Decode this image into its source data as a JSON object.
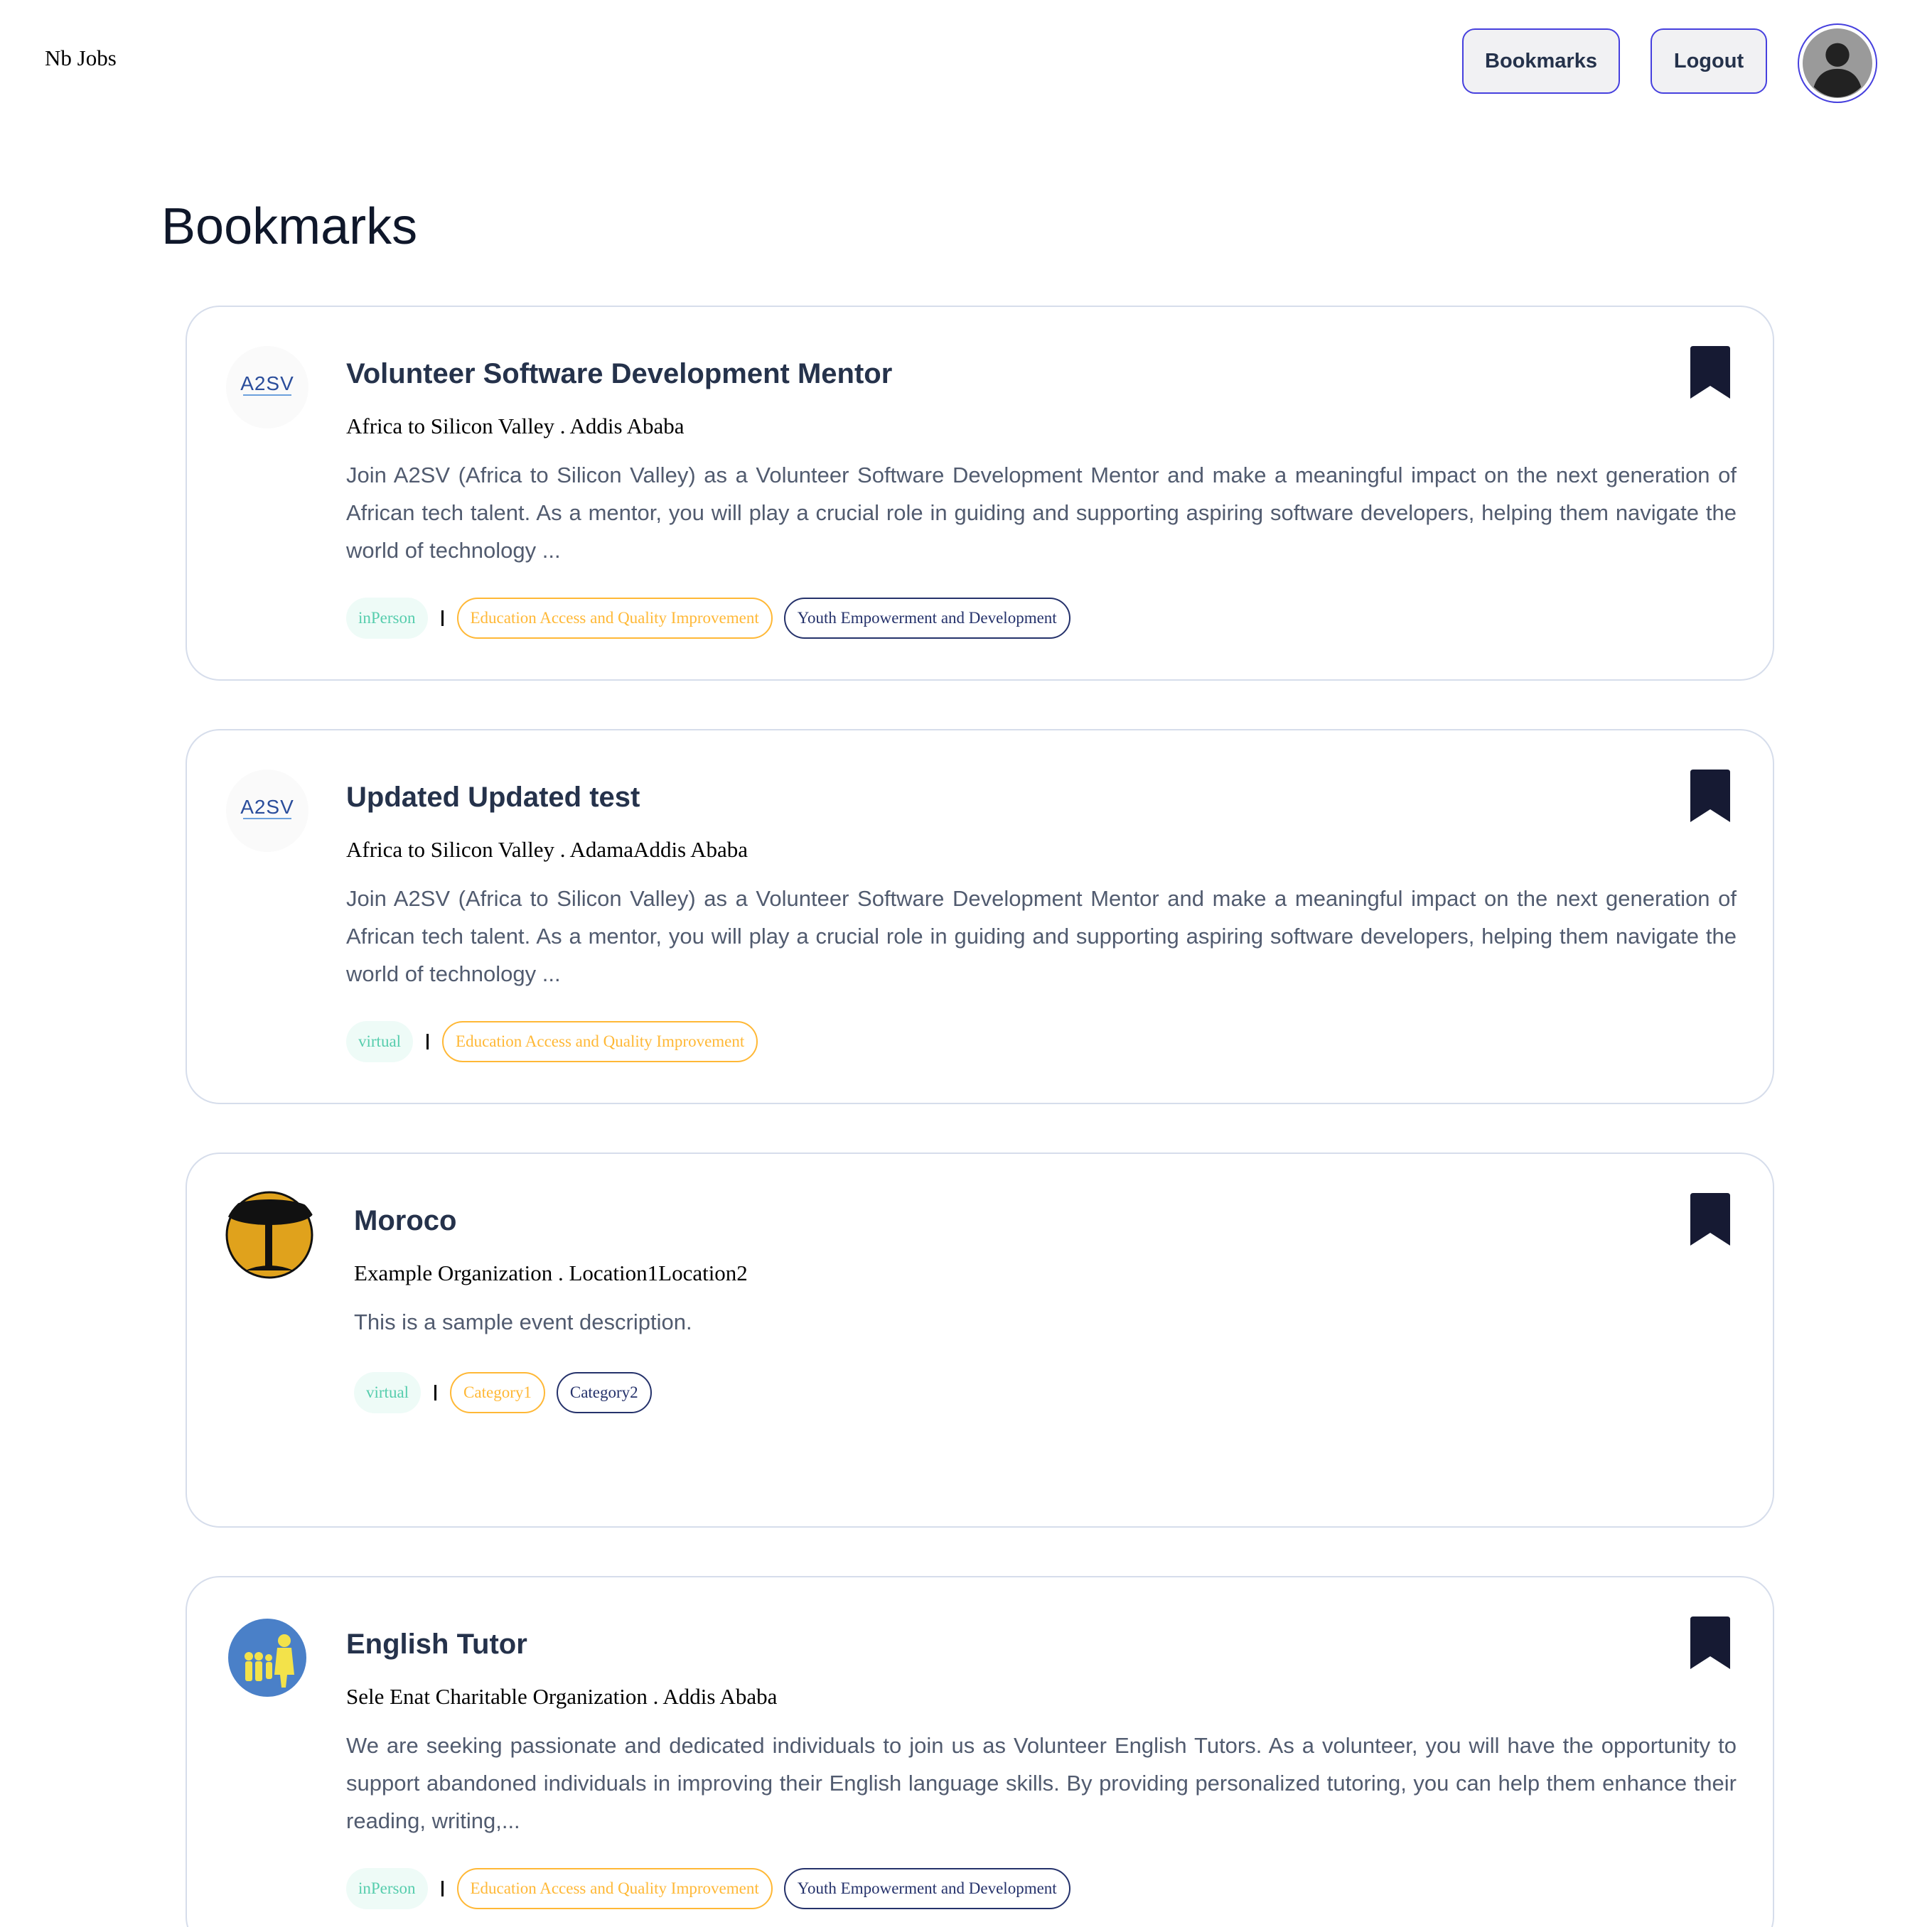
{
  "header": {
    "brand": "Nb Jobs",
    "bookmarks_label": "Bookmarks",
    "logout_label": "Logout"
  },
  "page": {
    "title": "Bookmarks"
  },
  "colors": {
    "accent": "#4640de",
    "mode_tag_text": "#56cdad",
    "mode_tag_bg": "#eefbf7",
    "category_primary": "#ffb836",
    "category_secondary": "#25326b",
    "bookmark_icon": "#161a33"
  },
  "cards": [
    {
      "title": "Volunteer Software Development Mentor",
      "org_line": "Africa to Silicon Valley . Addis Ababa",
      "description": "Join A2SV (Africa to Silicon Valley) as a Volunteer Software Development Mentor and make a meaningful impact on the next generation of African tech talent. As a mentor, you will play a crucial role in guiding and supporting aspiring software developers, helping them navigate the world of technology ...",
      "mode": "inPerson",
      "categories": [
        "Education Access and Quality Improvement",
        "Youth Empowerment and Development"
      ],
      "logo": "a2sv-logo"
    },
    {
      "title": "Updated Updated test",
      "org_line": "Africa to Silicon Valley . AdamaAddis Ababa",
      "description": "Join A2SV (Africa to Silicon Valley) as a Volunteer Software Development Mentor and make a meaningful impact on the next generation of African tech talent. As a mentor, you will play a crucial role in guiding and supporting aspiring software developers, helping them navigate the world of technology ...",
      "mode": "virtual",
      "categories": [
        "Education Access and Quality Improvement"
      ],
      "logo": "a2sv-logo"
    },
    {
      "title": "Moroco",
      "org_line": "Example Organization . Location1Location2",
      "description": "This is a sample event description.",
      "mode": "virtual",
      "categories": [
        "Category1",
        "Category2"
      ],
      "logo": "tree-logo"
    },
    {
      "title": "English Tutor",
      "org_line": "Sele Enat Charitable Organization . Addis Ababa",
      "description": "We are seeking passionate and dedicated individuals to join us as Volunteer English Tutors. As a volunteer, you will have the opportunity to support abandoned individuals in improving their English language skills. By providing personalized tutoring, you can help them enhance their reading, writing,...",
      "mode": "inPerson",
      "categories": [
        "Education Access and Quality Improvement",
        "Youth Empowerment and Development"
      ],
      "logo": "family-logo"
    }
  ]
}
